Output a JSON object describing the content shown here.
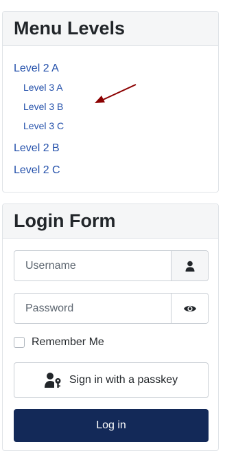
{
  "menu": {
    "title": "Menu Levels",
    "items": [
      {
        "label": "Level 2 A"
      },
      {
        "label": "Level 3 A"
      },
      {
        "label": "Level 3 B"
      },
      {
        "label": "Level 3 C"
      },
      {
        "label": "Level 2 B"
      },
      {
        "label": "Level 2 C"
      }
    ]
  },
  "login": {
    "title": "Login Form",
    "username_placeholder": "Username",
    "password_placeholder": "Password",
    "remember_label": "Remember Me",
    "passkey_label": "Sign in with a passkey",
    "login_label": "Log in"
  },
  "colors": {
    "link": "#224faa",
    "primary_button": "#132958",
    "arrow": "#8b0000"
  },
  "icons": {
    "username_addon": "user-icon",
    "password_addon": "eye-icon",
    "passkey": "user-key-icon"
  }
}
